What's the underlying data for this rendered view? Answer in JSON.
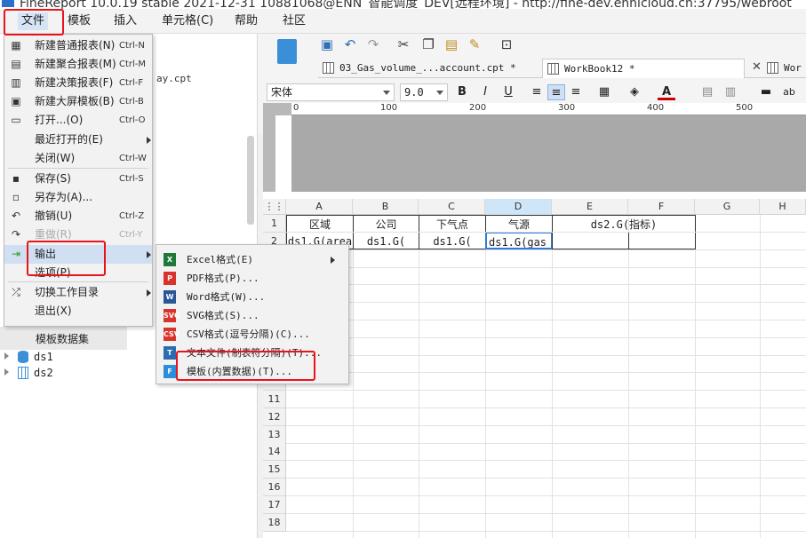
{
  "titlebar": {
    "text": "FineReport 10.0.19 stable 2021-12-31 10881068@ENN_智能调度_DEV[远程环境] - http://fine-dev.ennicloud.cn:37795/webroot"
  },
  "menubar": {
    "items": [
      "文件",
      "模板",
      "插入",
      "单元格(C)",
      "帮助",
      "社区"
    ]
  },
  "left_panel": {
    "file_suffix": "ay.cpt",
    "dataset_header": "模板数据集",
    "datasets": [
      "ds1",
      "ds2"
    ]
  },
  "file_menu": {
    "items": [
      {
        "label": "新建普通报表(N)",
        "shortcut": "Ctrl-N",
        "icon": "new-report-icon"
      },
      {
        "label": "新建聚合报表(M)",
        "shortcut": "Ctrl-M",
        "icon": "new-aggregate-icon"
      },
      {
        "label": "新建决策报表(F)",
        "shortcut": "Ctrl-F",
        "icon": "new-decision-icon"
      },
      {
        "label": "新建大屏模板(B)",
        "shortcut": "Ctrl-B",
        "icon": "new-screen-icon"
      },
      {
        "label": "打开...(O)",
        "shortcut": "Ctrl-O",
        "icon": "folder-open-icon"
      },
      {
        "label": "最近打开的(E)",
        "shortcut": "",
        "icon": ""
      },
      {
        "label": "关闭(W)",
        "shortcut": "Ctrl-W",
        "icon": ""
      },
      {
        "label": "保存(S)",
        "shortcut": "Ctrl-S",
        "icon": "save-icon"
      },
      {
        "label": "另存为(A)...",
        "shortcut": "",
        "icon": "save-as-icon"
      },
      {
        "label": "撤销(U)",
        "shortcut": "Ctrl-Z",
        "icon": "undo-icon"
      },
      {
        "label": "重做(R)",
        "shortcut": "Ctrl-Y",
        "icon": "redo-icon"
      },
      {
        "label": "输出",
        "shortcut": "",
        "icon": "export-icon"
      },
      {
        "label": "选项(P)",
        "shortcut": "",
        "icon": ""
      },
      {
        "label": "切换工作目录",
        "shortcut": "",
        "icon": "switch-icon"
      },
      {
        "label": "退出(X)",
        "shortcut": "",
        "icon": ""
      }
    ]
  },
  "export_submenu": {
    "items": [
      {
        "label": "Excel格式(E)",
        "icon": "excel-icon"
      },
      {
        "label": "PDF格式(P)...",
        "icon": "pdf-icon"
      },
      {
        "label": "Word格式(W)...",
        "icon": "word-icon"
      },
      {
        "label": "SVG格式(S)...",
        "icon": "svg-icon"
      },
      {
        "label": "CSV格式(逗号分隔)(C)...",
        "icon": "csv-icon"
      },
      {
        "label": "文本文件(制表符分隔)(T)...",
        "icon": "text-file-icon"
      },
      {
        "label": "模板(内置数据)(T)...",
        "icon": "template-embedded-icon"
      }
    ]
  },
  "tabs": [
    {
      "label": "03_Gas_volume_...account.cpt *"
    },
    {
      "label": "WorkBook12 *"
    },
    {
      "label": "Wor"
    }
  ],
  "format_bar": {
    "font": "宋体",
    "size": "9.0"
  },
  "ruler": {
    "ticks": [
      "0",
      "100",
      "200",
      "300",
      "400",
      "500"
    ]
  },
  "sheet": {
    "columns": [
      "A",
      "B",
      "C",
      "D",
      "E",
      "F",
      "G",
      "H"
    ],
    "rows": [
      "1",
      "2",
      "3",
      "4",
      "5",
      "6",
      "7",
      "8",
      "9",
      "10",
      "11",
      "12",
      "13",
      "14",
      "15",
      "16",
      "17",
      "18"
    ],
    "row1": [
      "区域",
      "公司",
      "下气点",
      "气源",
      "ds2.G(指标)"
    ],
    "row2": [
      "ds1.G(area",
      "ds1.G(",
      "ds1.G(",
      "ds1.G(gas_"
    ]
  },
  "colors": {
    "highlight": "#e8141b",
    "selection": "#2f7bd6"
  }
}
